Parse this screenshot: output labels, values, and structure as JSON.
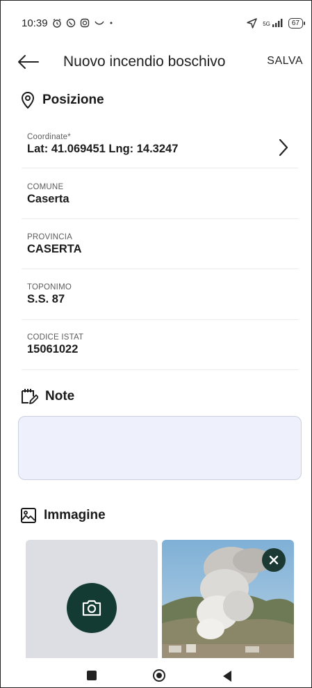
{
  "status_bar": {
    "time": "10:39",
    "signal_label": "5G",
    "battery": "67"
  },
  "app_bar": {
    "title": "Nuovo incendio boschivo",
    "save_label": "SALVA"
  },
  "position_section": {
    "title": "Posizione",
    "fields": [
      {
        "label": "Coordinate*",
        "value": "Lat: 41.069451 Lng: 14.3247"
      },
      {
        "label": "COMUNE",
        "value": "Caserta"
      },
      {
        "label": "PROVINCIA",
        "value": "CASERTA"
      },
      {
        "label": "TOPONIMO",
        "value": "S.S. 87"
      },
      {
        "label": "CODICE ISTAT",
        "value": "15061022"
      }
    ]
  },
  "notes_section": {
    "title": "Note",
    "value": ""
  },
  "image_section": {
    "title": "Immagine"
  },
  "colors": {
    "accent_dark": "#133a33",
    "note_bg": "#eef0fb",
    "note_border": "#c8d0e0",
    "camera_tile_bg": "#dcdee4"
  }
}
